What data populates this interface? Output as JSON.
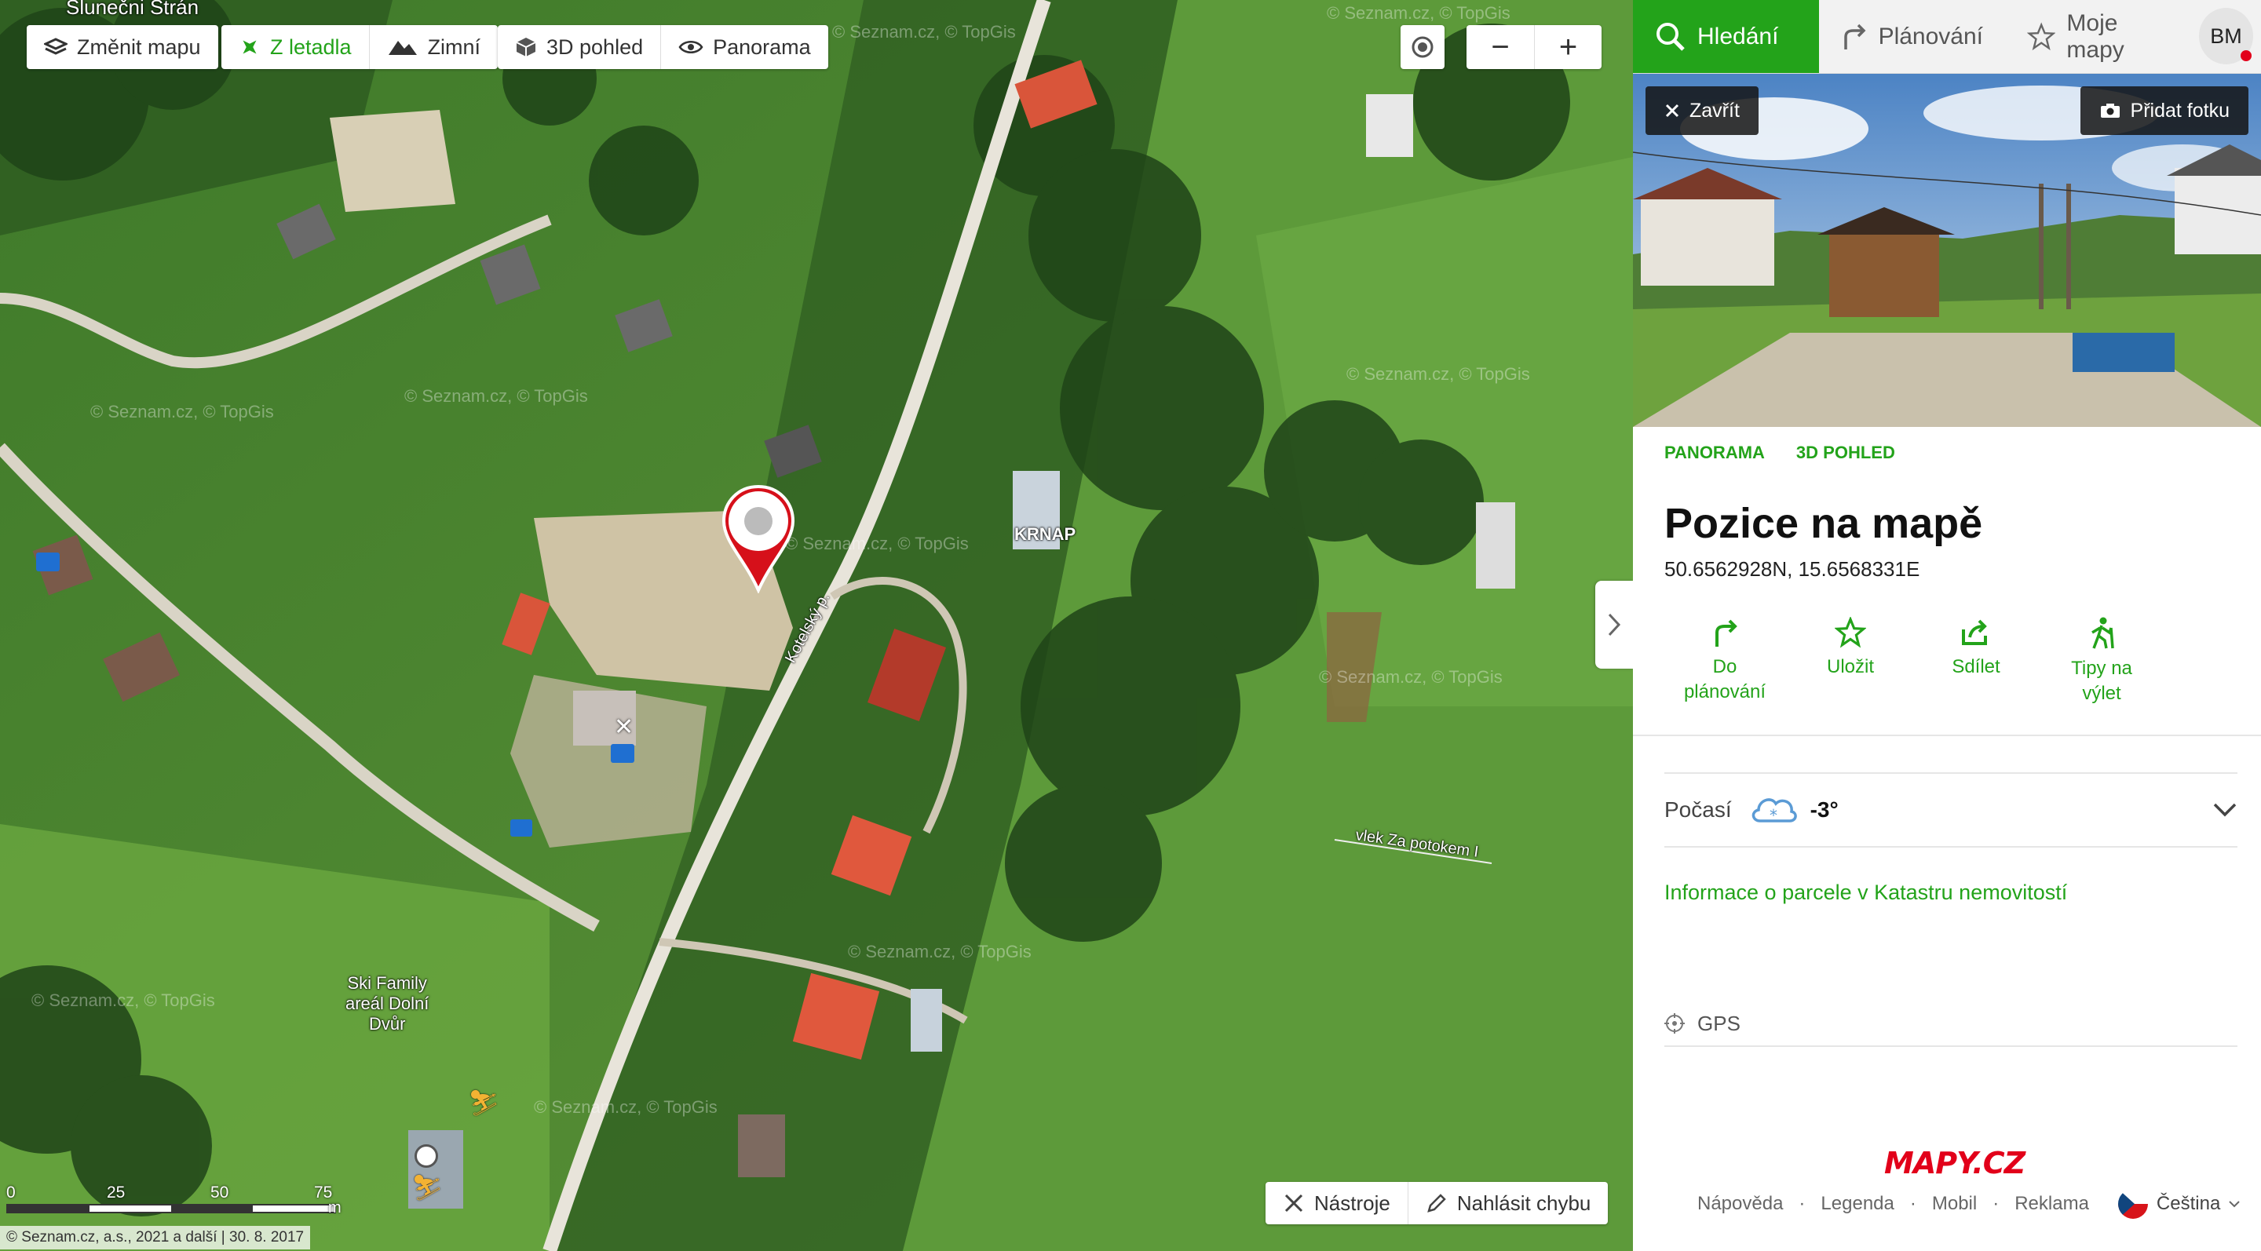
{
  "map": {
    "controls": {
      "change_map": "Změnit mapu",
      "aerial": "Z letadla",
      "winter": "Zimní",
      "view_3d": "3D pohled",
      "panorama": "Panorama",
      "zoom_out": "−",
      "zoom_in": "+"
    },
    "labels": {
      "top_left": "Slunečni Strán",
      "krnap": "KRNAP",
      "road": "Kotelský p.",
      "ski": "Ski Family areál Dolní Dvůr",
      "ski_line1": "Ski Family",
      "ski_line2": "areál Dolní",
      "ski_line3": "Dvůr",
      "lift": "vlek Za potokem I"
    },
    "watermark": "© Seznam.cz, © TopGis",
    "scale": {
      "ticks": [
        "0",
        "25",
        "50",
        "75"
      ],
      "unit": "m"
    },
    "copyright": "© Seznam.cz, a.s., 2021 a další | 30. 8. 2017",
    "tools": "Nástroje",
    "report": "Nahlásit chybu"
  },
  "panel": {
    "nav": {
      "search": "Hledání",
      "planning": "Plánování",
      "my_maps": "Moje mapy",
      "avatar": "BM"
    },
    "photo": {
      "close": "Zavřít",
      "add_photo": "Přidat fotku"
    },
    "sublinks": [
      "PANORAMA",
      "3D POHLED"
    ],
    "title": "Pozice na mapě",
    "coords": "50.6562928N, 15.6568331E",
    "actions": {
      "plan_l1": "Do",
      "plan_l2": "plánování",
      "save": "Uložit",
      "share": "Sdílet",
      "trip_l1": "Tipy na",
      "trip_l2": "výlet"
    },
    "weather": {
      "label": "Počasí",
      "temp": "-3°"
    },
    "kataster": "Informace o parcele v Katastru nemovitostí",
    "gps": "GPS",
    "logo": "MAPY.CZ",
    "footer": {
      "help": "Nápověda",
      "legend": "Legenda",
      "mobile": "Mobil",
      "ads": "Reklama",
      "language": "Čeština"
    }
  },
  "colors": {
    "accent": "#23a31a",
    "brand_red": "#e2001a"
  }
}
